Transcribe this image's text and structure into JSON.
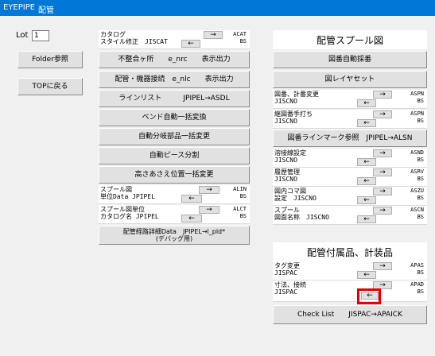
{
  "menubar": {
    "app": "EYEPIPE",
    "menu1": "配管"
  },
  "left": {
    "lot_label": "Lot",
    "lot_value": "1",
    "folder_button": "Folder参照",
    "top_button": "TOPに戻る"
  },
  "middle": {
    "row_catalog": {
      "text": "カタログ\nスタイル修正　JISCAT",
      "code": "ACAT\nBS"
    },
    "btn_fusei": "不整合ヶ所　　e_nrc　　表示出力",
    "btn_haikan": "配管・機器接続　e_nlc　　表示出力",
    "btn_line": "ラインリスト　　　JPIPEL→ASDL",
    "btn_bend": "ベンド自動一括変換",
    "btn_bunki": "自動分岐部品一括変更",
    "btn_piece": "自動ピース分割",
    "btn_takasa": "高さあさえ位置一括変更",
    "row_spool_tanni": {
      "text": "スプール図\n単位Data JPIPEL",
      "code": "ALIN\nBS"
    },
    "row_spool_cat": {
      "text": "スプール図単位\nカタログ名 JPIPEL",
      "code": "ALCT\nBS"
    },
    "btn_debug": "配管経路詳細Data　JPIPEL→l_pld*\n(デバッグ用)"
  },
  "right": {
    "spool_title": "配管スプール図",
    "btn_auto_num": "図番自動採番",
    "btn_layout": "図レイヤセット",
    "row_zuban": {
      "text": "図番、計番変更\nJISCNO",
      "code": "ASPN\nBS"
    },
    "row_tsugi": {
      "text": "継図番手打ち\nJISCNO",
      "code": "ASPN\nBS"
    },
    "btn_linemark": "図番ラインマーク参照　JPIPEL→ALSN",
    "row_kakushu": {
      "text": "溶接線設定\nJISCNO",
      "code": "ASND\nBS"
    },
    "row_rireki": {
      "text": "履歴管理\nJISCNO",
      "code": "ASRV\nBS"
    },
    "row_zunai": {
      "text": "図内コマ図\n設定　JISCNO",
      "code": "ASZU\nBS"
    },
    "row_spool_name": {
      "text": "スプール\n図面名称　JISCNO",
      "code": "ASCN\nBS"
    },
    "fuzoku_title": "配管付属品、計装品",
    "row_tag": {
      "text": "タグ変更\nJISPAC",
      "code": "APAS\nBS"
    },
    "row_sunpo": {
      "text": "寸法、接続\nJISPAC",
      "code": "APAD\nBS"
    },
    "btn_check": "Check List　　JISPAC→APAICK"
  },
  "arrows": {
    "right": "→",
    "left": "←"
  }
}
